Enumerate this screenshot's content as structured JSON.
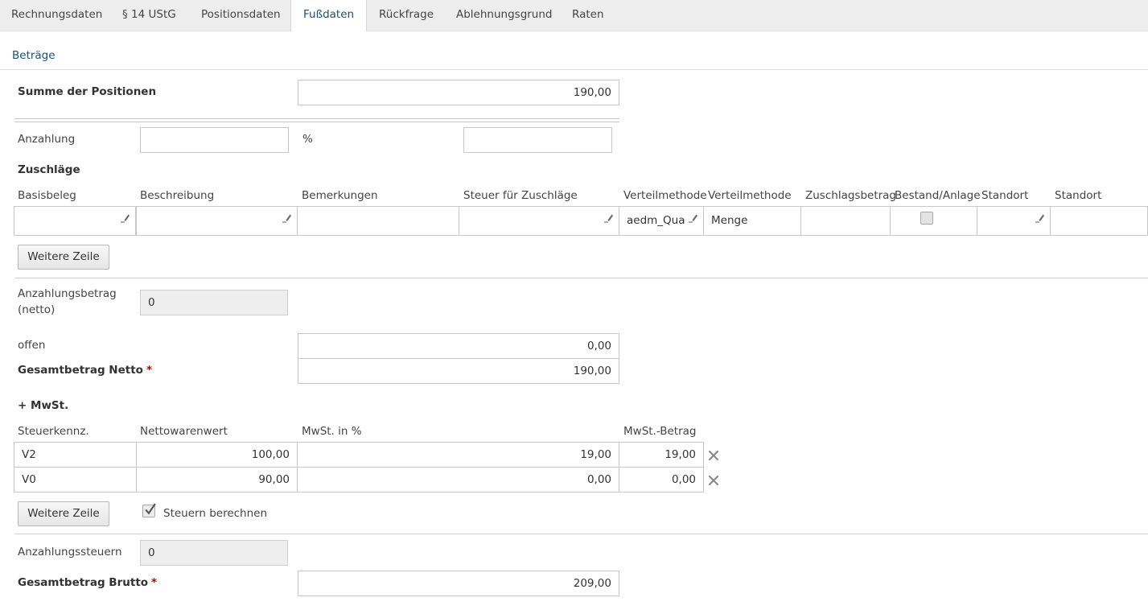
{
  "tabs": [
    "Rechnungsdaten",
    "§ 14 UStG",
    "Positionsdaten",
    "Fußdaten",
    "Rückfrage",
    "Ablehnungsgrund",
    "Raten"
  ],
  "active_tab": "Fußdaten",
  "section_title": "Beträge",
  "summe": {
    "label": "Summe der Positionen",
    "value": "190,00"
  },
  "anzahlung": {
    "label": "Anzahlung",
    "value": "",
    "percent_label": "%",
    "percent_value": ""
  },
  "zuschlaege": {
    "title": "Zuschläge",
    "columns": [
      "Basisbeleg",
      "Beschreibung",
      "Bemerkungen",
      "Steuer für Zuschläge",
      "Verteilmethode",
      "Verteilmethode",
      "Zuschlagsbetrag",
      "Bestand/Anlage",
      "Standort",
      "Standort"
    ],
    "row": {
      "basisbeleg": "",
      "beschreibung": "",
      "bemerkungen": "",
      "steuer": "",
      "verteilmethode_code": "aedm_Qua",
      "verteilmethode_name": "Menge",
      "zuschlagsbetrag": "",
      "bestand_anlage_checked": false,
      "standort_code": "",
      "standort_name": ""
    },
    "add_row_button": "Weitere Zeile"
  },
  "anzahlungsbetrag": {
    "label_line1": "Anzahlungsbetrag",
    "label_line2": "(netto)",
    "value": "0"
  },
  "offen": {
    "label": "offen",
    "value": "0,00"
  },
  "gesamt_netto": {
    "label": "Gesamtbetrag Netto",
    "required_mark": "*",
    "value": "190,00"
  },
  "mwst": {
    "title": "+ MwSt.",
    "columns": [
      "Steuerkennz.",
      "Nettowarenwert",
      "MwSt. in %",
      "MwSt.-Betrag"
    ],
    "rows": [
      {
        "kennz": "V2",
        "netto": "100,00",
        "prozent": "19,00",
        "betrag": "19,00"
      },
      {
        "kennz": "V0",
        "netto": "90,00",
        "prozent": "0,00",
        "betrag": "0,00"
      }
    ],
    "add_row_button": "Weitere Zeile",
    "calc_taxes_label": "Steuern berechnen",
    "calc_taxes_checked": true
  },
  "anzahlungssteuern": {
    "label": "Anzahlungssteuern",
    "value": "0"
  },
  "gesamt_brutto": {
    "label": "Gesamtbetrag Brutto",
    "required_mark": "*",
    "value": "209,00"
  },
  "colors": {
    "accent": "#1b4f7a",
    "required": "#b00000",
    "border": "#c8c8c8"
  }
}
